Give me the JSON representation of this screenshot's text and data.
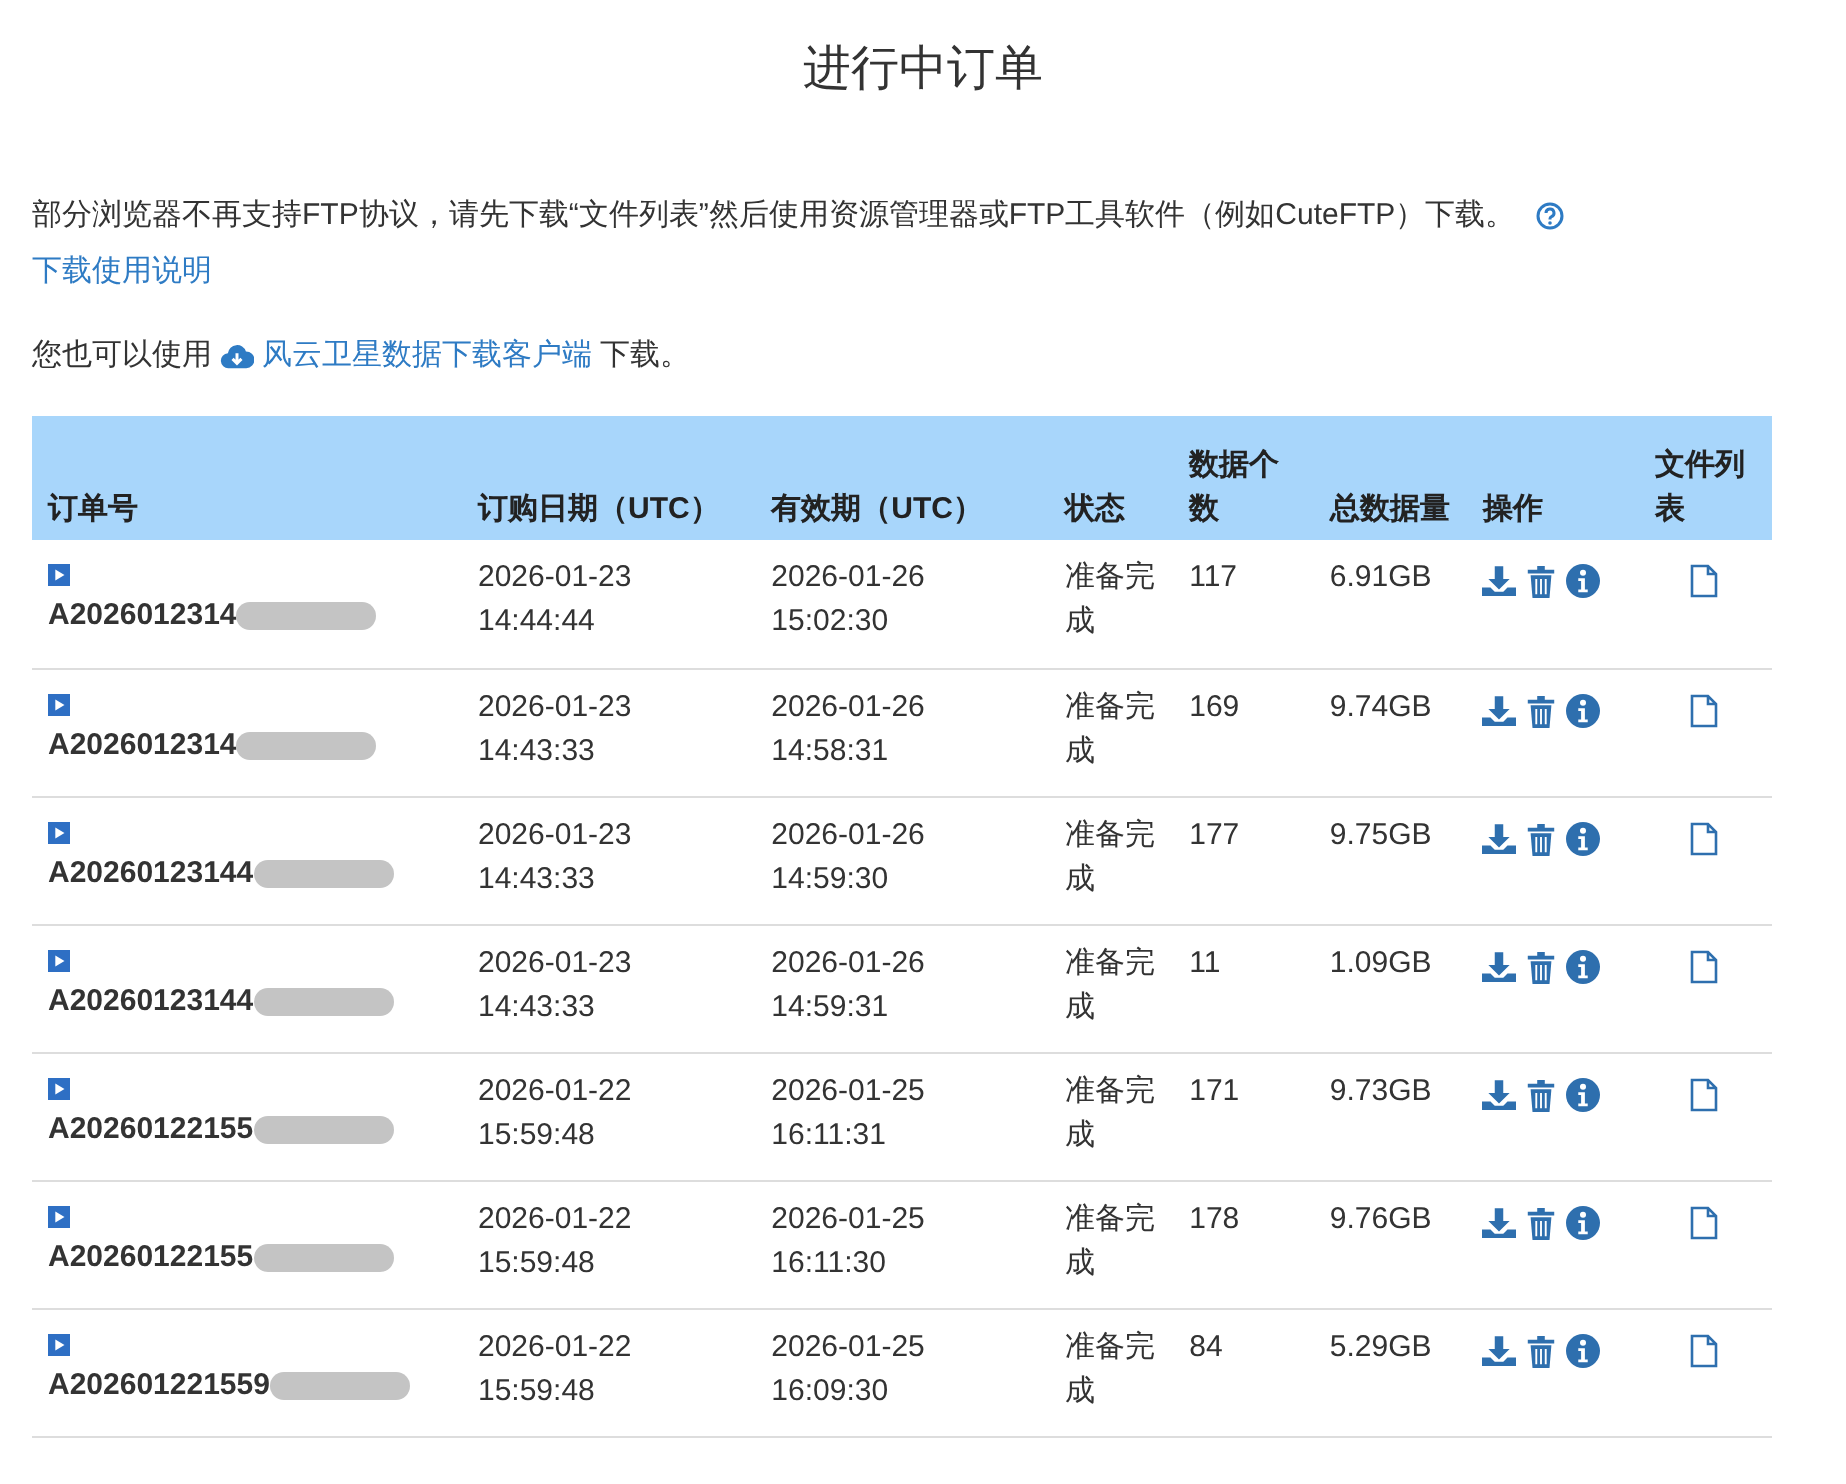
{
  "page_title": "进行中订单",
  "notice": {
    "text": "部分浏览器不再支持FTP协议，请先下载“文件列表”然后使用资源管理器或FTP工具软件（例如CuteFTP）下载。",
    "help_link": "下载使用说明"
  },
  "client_line": {
    "before": "您也可以使用",
    "link": "风云卫星数据下载客户端",
    "after": "下载。"
  },
  "table": {
    "columns": [
      "订单号",
      "订购日期（UTC）",
      "有效期（UTC）",
      "状态",
      "数据个数",
      "总数据量",
      "操作",
      "文件列表"
    ],
    "rows": [
      {
        "order": "A2026012314",
        "redacted": true,
        "ordered": "2026-01-23 14:44:44",
        "expires": "2026-01-26 15:02:30",
        "status": "准备完成",
        "count": "117",
        "size": "6.91GB"
      },
      {
        "order": "A2026012314",
        "redacted": true,
        "ordered": "2026-01-23 14:43:33",
        "expires": "2026-01-26 14:58:31",
        "status": "准备完成",
        "count": "169",
        "size": "9.74GB"
      },
      {
        "order": "A20260123144",
        "redacted": true,
        "ordered": "2026-01-23 14:43:33",
        "expires": "2026-01-26 14:59:30",
        "status": "准备完成",
        "count": "177",
        "size": "9.75GB"
      },
      {
        "order": "A20260123144",
        "redacted": true,
        "ordered": "2026-01-23 14:43:33",
        "expires": "2026-01-26 14:59:31",
        "status": "准备完成",
        "count": "11",
        "size": "1.09GB"
      },
      {
        "order": "A20260122155",
        "redacted": true,
        "ordered": "2026-01-22 15:59:48",
        "expires": "2026-01-25 16:11:31",
        "status": "准备完成",
        "count": "171",
        "size": "9.73GB"
      },
      {
        "order": "A20260122155",
        "redacted": true,
        "ordered": "2026-01-22 15:59:48",
        "expires": "2026-01-25 16:11:30",
        "status": "准备完成",
        "count": "178",
        "size": "9.76GB"
      },
      {
        "order": "A202601221559",
        "redacted": true,
        "ordered": "2026-01-22 15:59:48",
        "expires": "2026-01-25 16:09:30",
        "status": "准备完成",
        "count": "84",
        "size": "5.29GB"
      }
    ]
  }
}
